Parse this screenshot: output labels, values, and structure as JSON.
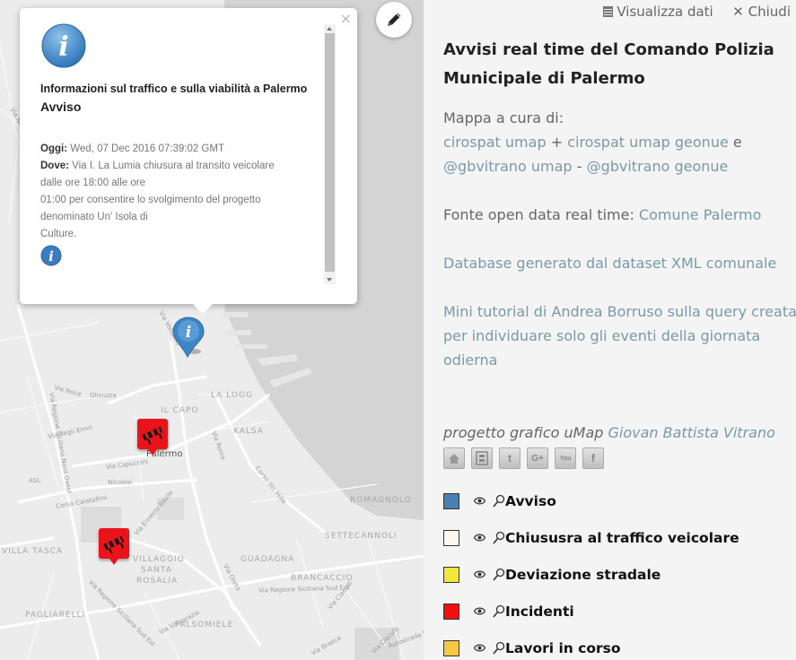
{
  "popup": {
    "heading": "Informazioni sul traffico e sulla viabilità a Palermo",
    "subheading": "Avviso",
    "date_label": "Oggi:",
    "date_value": "Wed, 07 Dec 2016 07:39:02 GMT",
    "where_label": "Dove:",
    "where_line1": "Via I. La Lumia chiusura al transito veicolare",
    "where_line2": "dalle ore 18:00 alle ore",
    "where_line3": "01:00 per consentire lo svolgimento del progetto",
    "where_line4": "denominato Un' Isola di",
    "where_line5": "Culture.",
    "close": "×"
  },
  "map": {
    "city": "Palermo",
    "districts": [
      "IL CAPO",
      "KALSA",
      "LA LOGG",
      "VILLA TASCA",
      "VILLAGGIO",
      "SANTA",
      "ROSALIA",
      "GUADAGNA",
      "BRANCACCIO",
      "PAGLIARELLI",
      "FALSOMIELE",
      "ROMAGNOLO",
      "SETTECANNOLI"
    ],
    "streets": [
      "Via Noce",
      "Via Volturno",
      "Via degli Emiri",
      "Via Capuccini",
      "Corso Calatafimi",
      "Via Ernesto Basile",
      "Corso dei Mille",
      "Via Regione Siciliana Sud Est",
      "Via Villagrazia",
      "Via Messina Marine",
      "Via Roma",
      "Via Oreto",
      "Via Brasca",
      "Via Ciaculli",
      "Autostrada Palermo-Catania",
      "Via Regione Siciliana Nord Ovest",
      "Olivuzza",
      "ASL",
      "Nicolosi",
      "Vio G. Sicari"
    ]
  },
  "panel": {
    "view_data": "Visualizza dati",
    "close": "Chiudi",
    "title": "Avvisi real time del Comando Polizia Municipale di Palermo",
    "credits_intro": "Mappa a cura di:",
    "link_cirospat_umap": "cirospat umap",
    "plus": "+",
    "link_cirospat_geonue": "cirospat umap geonue",
    "and": "e",
    "link_gbvitrano_umap": "@gbvitrano umap",
    "dash": "-",
    "link_gbvitrano_geonue": "@gbvitrano geonue",
    "source_label": "Fonte open data real time:",
    "link_comune": "Comune Palermo",
    "database_text": "Database generato dal dataset XML comunale",
    "tutorial_text": "Mini tutorial di Andrea Borruso sulla query creata per individuare solo gli eventi della giornata odierna",
    "graphic_label": "progetto grafico uMap",
    "link_designer": "Giovan Battista Vitrano",
    "social": [
      "home-icon",
      "qr-icon",
      "twitter-icon",
      "googleplus-icon",
      "youtube-icon",
      "facebook-icon"
    ]
  },
  "legend": [
    {
      "label": "Avviso",
      "color": "#4a7fb0"
    },
    {
      "label": "Chiususra al traffico veicolare",
      "color": "#fdf7f1"
    },
    {
      "label": "Deviazione stradale",
      "color": "#f2e63a"
    },
    {
      "label": "Incidenti",
      "color": "#f01010"
    },
    {
      "label": "Lavori in corso",
      "color": "#f5c842"
    }
  ],
  "colors": {
    "marker_red": "#e8141a",
    "marker_blue": "#3f86c7",
    "sea": "#d4d4d4",
    "link": "#7a9aa8"
  }
}
